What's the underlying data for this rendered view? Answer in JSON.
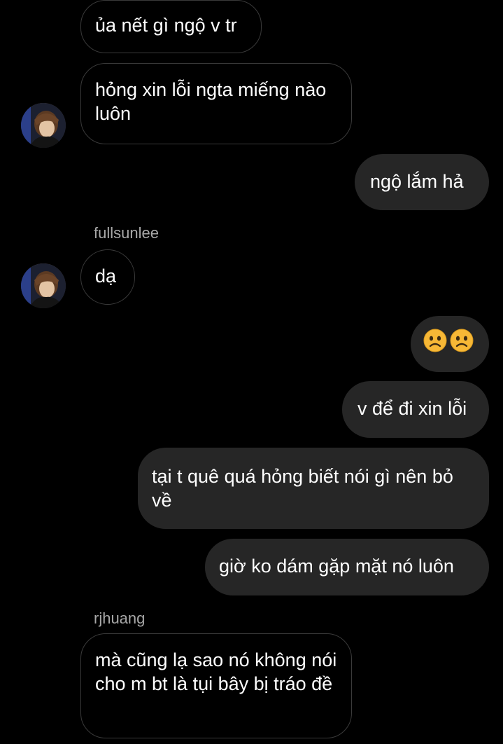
{
  "messages": [
    {
      "id": "m1",
      "direction": "incoming",
      "text": "ủa nết gì ngộ v tr"
    },
    {
      "id": "m2",
      "direction": "incoming",
      "text": "hỏng xin lỗi ngta miếng nào luôn"
    },
    {
      "id": "m3",
      "direction": "outgoing",
      "text": "ngộ lắm hả"
    },
    {
      "id": "m4",
      "direction": "incoming",
      "sender": "fullsunlee",
      "text": "dạ"
    },
    {
      "id": "m5",
      "direction": "outgoing",
      "emoji": [
        "worried-face-emoji",
        "worried-face-emoji"
      ]
    },
    {
      "id": "m6",
      "direction": "outgoing",
      "text": "v để đi xin lỗi"
    },
    {
      "id": "m7",
      "direction": "outgoing",
      "text": "tại t quê quá hỏng biết nói gì nên bỏ về"
    },
    {
      "id": "m8",
      "direction": "outgoing",
      "text": "giờ ko dám gặp mặt nó luôn"
    },
    {
      "id": "m9",
      "direction": "incoming",
      "sender": "rjhuang",
      "text": "mà cũng lạ sao nó không nói cho m bt là tụi bây bị tráo đề"
    }
  ],
  "colors": {
    "background": "#000000",
    "outgoing_bubble": "#262626",
    "incoming_border": "#3a3a3a",
    "sender_text": "#a8a8a8",
    "emoji_yellow": "#f7b836"
  }
}
